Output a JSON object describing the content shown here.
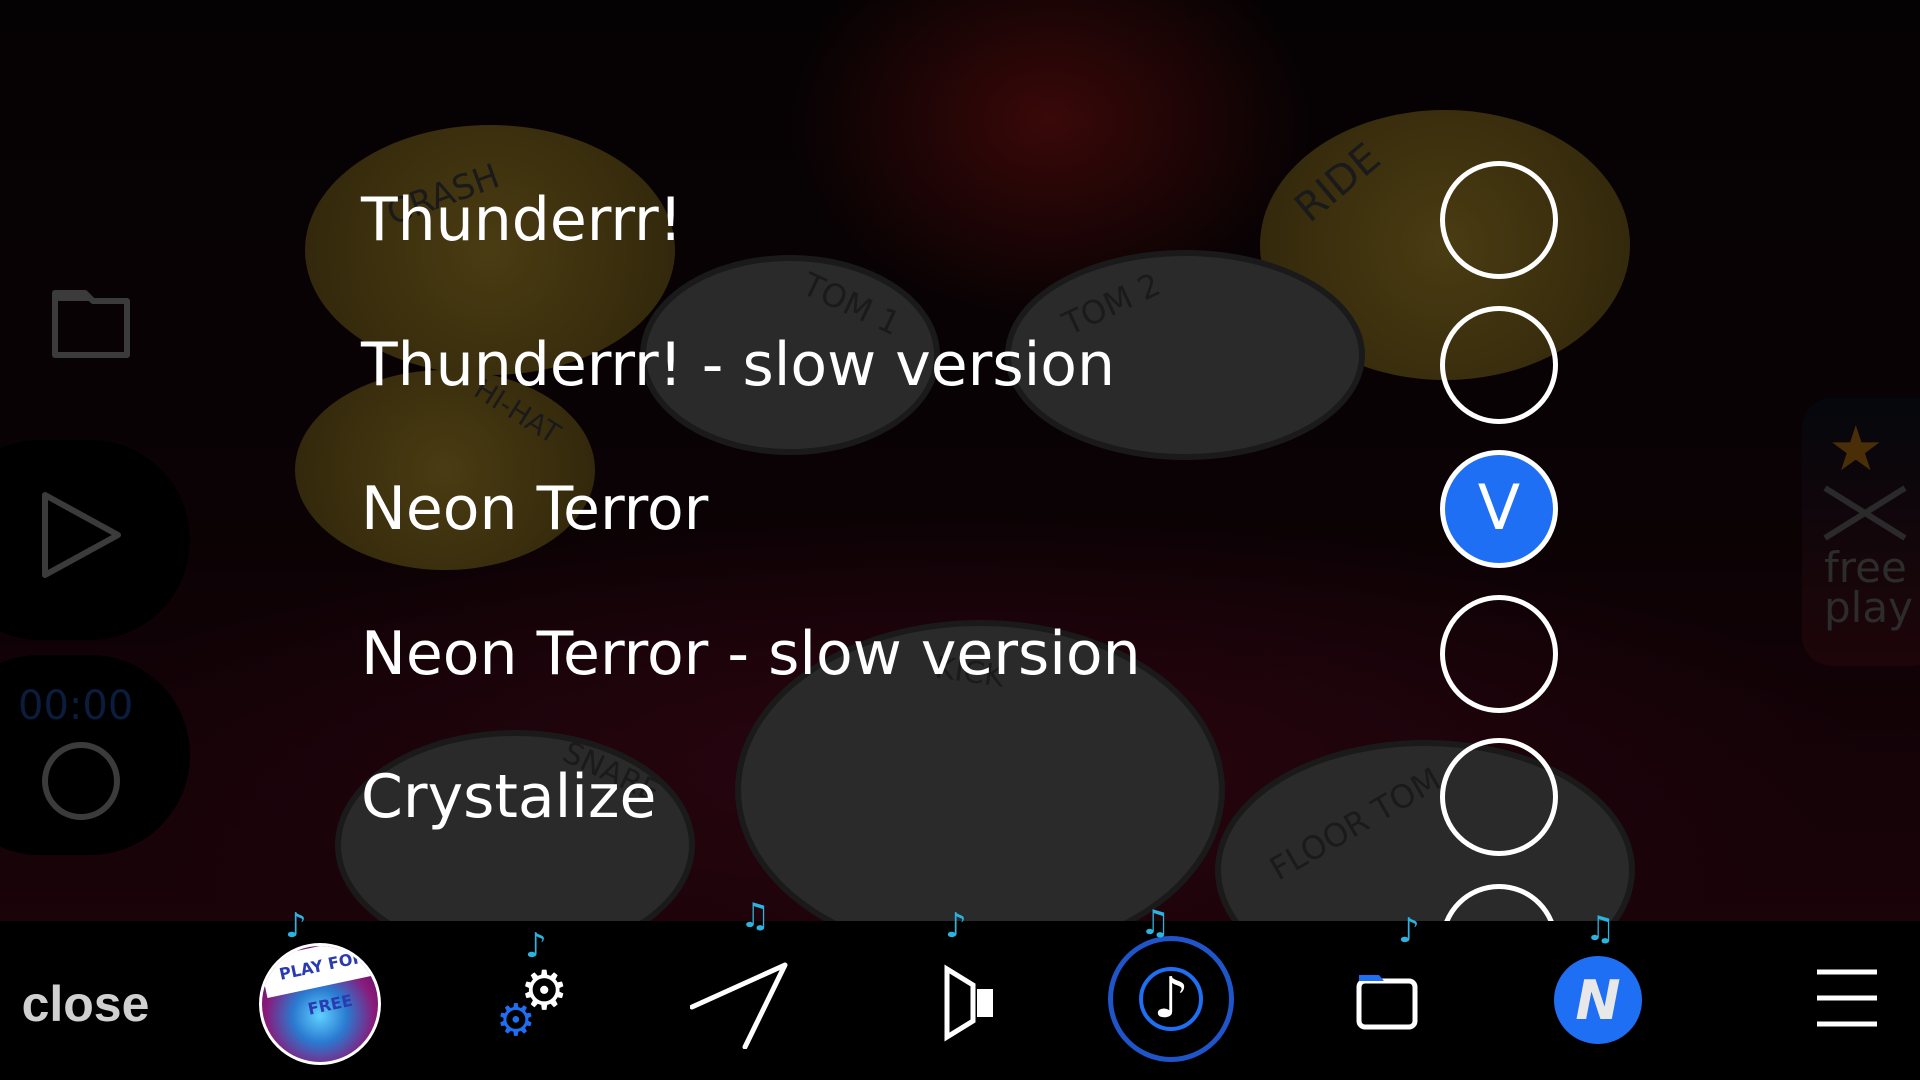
{
  "songs": [
    {
      "title": "Thunderrr!",
      "selected": false
    },
    {
      "title": "Thunderrr! - slow version",
      "selected": false
    },
    {
      "title": "Neon Terror",
      "selected": true
    },
    {
      "title": "Neon Terror - slow version",
      "selected": false
    },
    {
      "title": "Crystalize",
      "selected": false
    },
    {
      "title": "",
      "selected": false
    }
  ],
  "check_mark": "V",
  "drum_labels": {
    "crash": "CRASH",
    "ride": "RIDE",
    "tom1": "TOM 1",
    "tom2": "TOM 2",
    "floor": "FLOOR TOM",
    "hihat": "HI-HAT",
    "kick": "KICK",
    "snare": "SNARE"
  },
  "left_panel": {
    "timer": "00:00",
    "icons": [
      "folder-icon",
      "play-icon",
      "record-icon"
    ]
  },
  "right_panel": {
    "label_line1": "free",
    "label_line2": "play"
  },
  "bottom_bar": {
    "close_label": "close",
    "play_free_label": "PLAY FOR FREE",
    "icons": [
      "play-for-free-icon",
      "settings-icon",
      "drumsticks-icon",
      "speaker-icon",
      "music-note-icon",
      "folder-icon",
      "n-logo-icon",
      "menu-icon"
    ]
  },
  "colors": {
    "accent": "#1f6ff5",
    "note": "#2bb4e0",
    "dim": "#3b3b3b"
  }
}
